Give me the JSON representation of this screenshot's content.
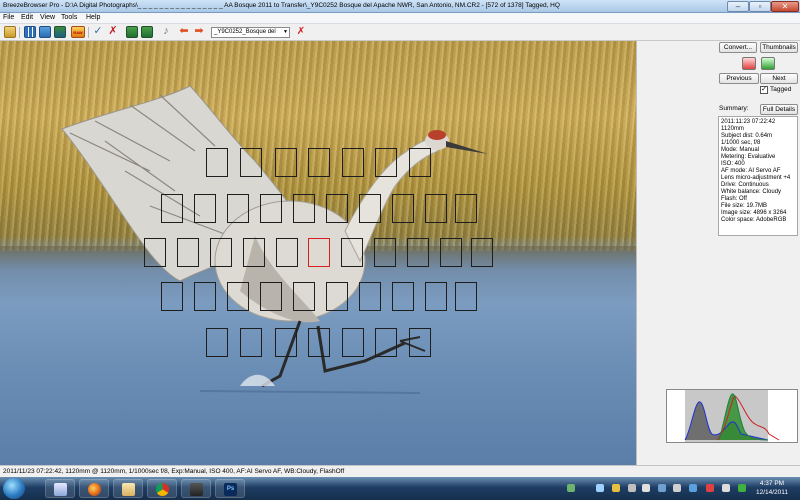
{
  "window": {
    "title": "BreezeBrowser Pro - D:\\A Digital Photographs\\_ _ _ _ _ _ _ _ _ _ _ _ _ _ _ _  AA Bosque 2011 to Transfer\\_Y9C0252  Bosque del Apache NWR, San Antonio, NM.CR2 - [572 of 1378] Tagged, HQ",
    "minimize": "–",
    "maximize": "▫",
    "close": "✕"
  },
  "menu": [
    "File",
    "Edit",
    "View",
    "Tools",
    "Help"
  ],
  "toolbar": {
    "raw_label": "RAW",
    "file_select": "_Y9C0252_Bosque del"
  },
  "panel": {
    "convert_label": "Convert...",
    "thumbnails_label": "Thumbnails",
    "previous_label": "Previous",
    "next_label": "Next",
    "tagged_label": "Tagged",
    "tagged_checked": true,
    "summary_label": "Summary:",
    "full_details_label": "Full Details",
    "info_lines": [
      "2011:11:23 07:22:42",
      "1120mm",
      "Subject dist: 0.64m",
      "1/1000 sec, f/8",
      "Mode: Manual",
      "Metering: Evaluative",
      "ISO: 400",
      "AF mode: AI Servo AF",
      "Lens micro-adjustment +4",
      "Drive: Continuous",
      "White balance: Cloudy",
      "Flash: Off",
      "File size: 19.7MB",
      "Image size: 4896 x 3264",
      "Color space: AdobeRGB"
    ]
  },
  "status": {
    "text": "2011/11/23 07:22:42, 1120mm @ 1120mm, 1/1000sec f/8, Exp:Manual, ISO 400, AF:AI Servo AF, WB:Cloudy, FlashOff"
  },
  "taskbar": {
    "time": "4:37 PM",
    "date": "12/14/2011"
  },
  "colors": {
    "af_point": "#1e1e1e",
    "af_point_active": "#d82020",
    "histogram_blue": "#2030d0",
    "histogram_green": "#208040",
    "histogram_red": "#d02020"
  }
}
